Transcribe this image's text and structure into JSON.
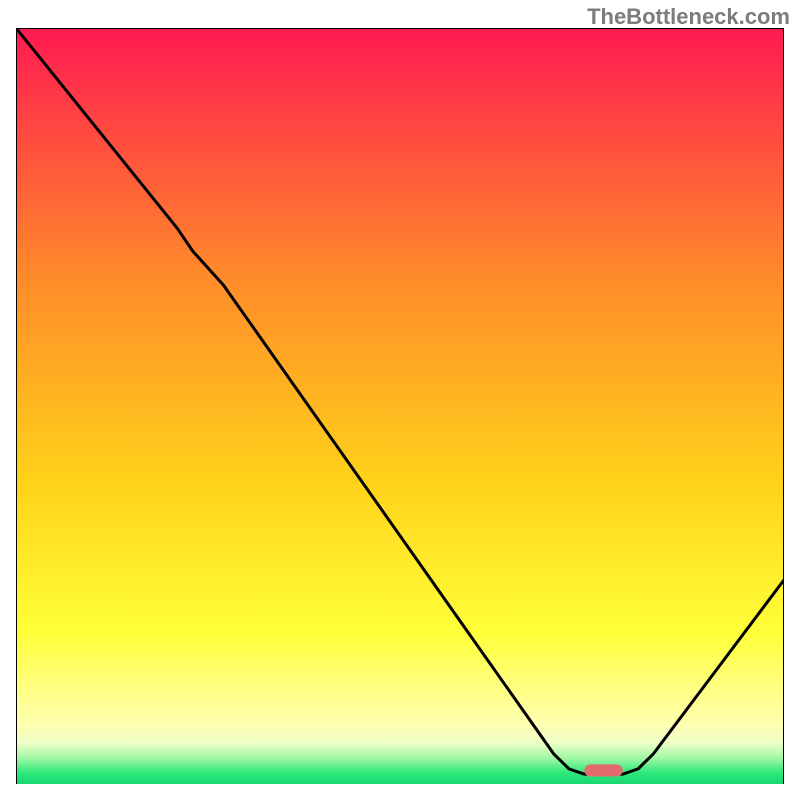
{
  "watermark": "TheBottleneck.com",
  "chart_data": {
    "type": "line",
    "title": "",
    "xlabel": "",
    "ylabel": "",
    "xlim": [
      0,
      100
    ],
    "ylim": [
      0,
      100
    ],
    "gradient_stops": [
      {
        "offset": 0.0,
        "color": "#ff1a51"
      },
      {
        "offset": 0.33,
        "color": "#ff8b2a"
      },
      {
        "offset": 0.6,
        "color": "#ffd21a"
      },
      {
        "offset": 0.8,
        "color": "#ffff3a"
      },
      {
        "offset": 0.92,
        "color": "#ffffb0"
      },
      {
        "offset": 0.945,
        "color": "#f0ffc8"
      },
      {
        "offset": 0.965,
        "color": "#a4f8a5"
      },
      {
        "offset": 0.985,
        "color": "#2fe87a"
      },
      {
        "offset": 1.0,
        "color": "#17d970"
      }
    ],
    "curve": [
      {
        "x": 0.0,
        "y": 100.0
      },
      {
        "x": 21.0,
        "y": 73.5
      },
      {
        "x": 23.0,
        "y": 70.5
      },
      {
        "x": 27.0,
        "y": 66.0
      },
      {
        "x": 70.0,
        "y": 4.0
      },
      {
        "x": 72.0,
        "y": 2.0
      },
      {
        "x": 74.0,
        "y": 1.3
      },
      {
        "x": 79.0,
        "y": 1.3
      },
      {
        "x": 81.0,
        "y": 2.0
      },
      {
        "x": 83.0,
        "y": 4.0
      },
      {
        "x": 100.0,
        "y": 27.0
      }
    ],
    "marker": {
      "x": 76.5,
      "y": 1.8,
      "width": 5.0,
      "height": 1.6,
      "color": "#e26b6e"
    }
  }
}
